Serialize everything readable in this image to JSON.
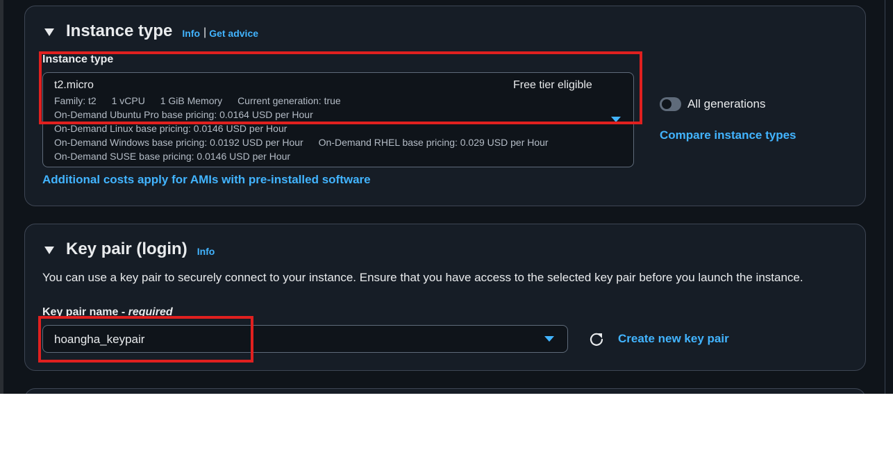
{
  "instance_type_section": {
    "title": "Instance type",
    "info": "Info",
    "separator": "|",
    "get_advice": "Get advice",
    "field_label": "Instance type",
    "selected": {
      "name": "t2.micro",
      "badge": "Free tier eligible",
      "family": "Family: t2",
      "vcpu": "1 vCPU",
      "memory": "1 GiB Memory",
      "generation": "Current generation: true",
      "ubuntu_pro": "On-Demand Ubuntu Pro base pricing: 0.0164 USD per Hour",
      "linux": "On-Demand Linux base pricing: 0.0146 USD per Hour",
      "windows": "On-Demand Windows base pricing: 0.0192 USD per Hour",
      "rhel": "On-Demand RHEL base pricing: 0.029 USD per Hour",
      "suse": "On-Demand SUSE base pricing: 0.0146 USD per Hour"
    },
    "all_generations": "All generations",
    "all_generations_on": false,
    "compare": "Compare instance types",
    "additional_costs": "Additional costs apply for AMIs with pre-installed software"
  },
  "key_pair_section": {
    "title": "Key pair (login)",
    "info": "Info",
    "description": "You can use a key pair to securely connect to your instance. Ensure that you have access to the selected key pair before you launch the instance.",
    "field_label": "Key pair name - ",
    "field_required": "required",
    "selected_key": "hoangha_keypair",
    "create_new": "Create new key pair"
  },
  "colors": {
    "background": "#0f141a",
    "panel": "#161d26",
    "link": "#42b4ff",
    "highlight": "#e0201f"
  },
  "icons": [
    "caret-down-icon",
    "dropdown-arrow-icon",
    "refresh-icon",
    "toggle-switch"
  ]
}
